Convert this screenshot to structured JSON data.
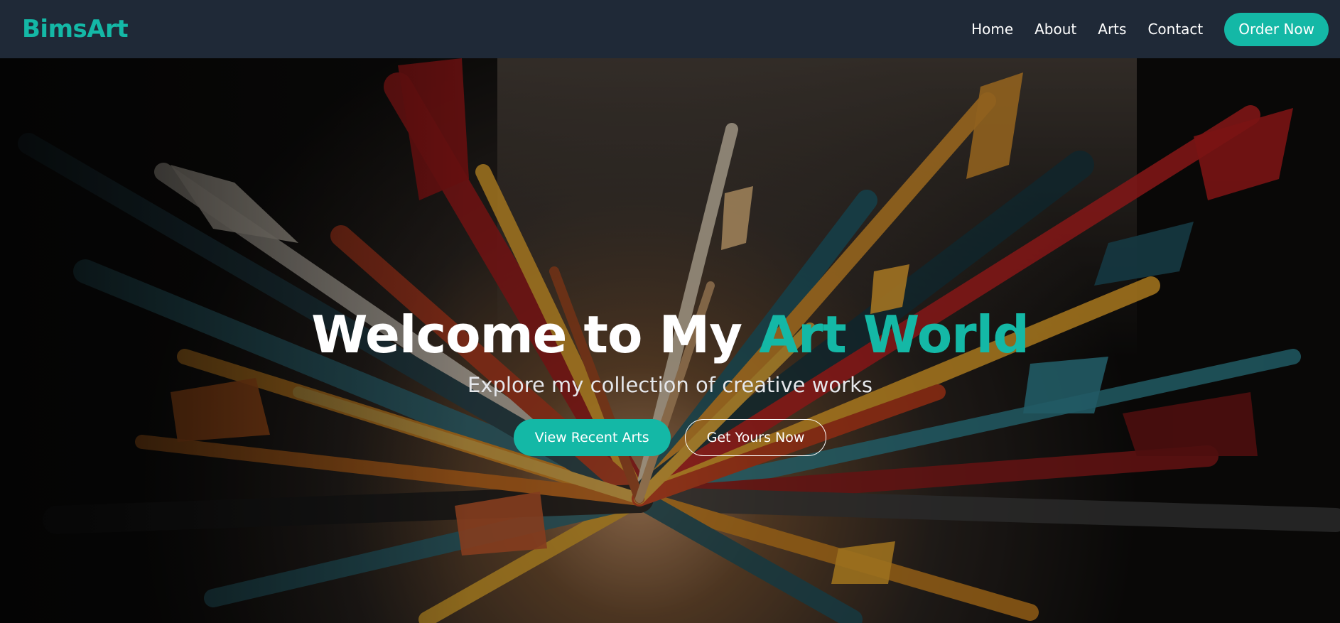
{
  "nav": {
    "logo": "BimsArt",
    "links": [
      "Home",
      "About",
      "Arts",
      "Contact"
    ],
    "cta": "Order Now"
  },
  "hero": {
    "title_main": "Welcome to My ",
    "title_accent": "Art World",
    "subtitle": "Explore my collection of creative works",
    "primary_button": "View Recent Arts",
    "secondary_button": "Get Yours Now",
    "background_image": "abstract-paint-explosion"
  },
  "colors": {
    "accent": "#14b8a6",
    "navbar_bg": "#1f2937",
    "text_light": "#ffffff"
  }
}
